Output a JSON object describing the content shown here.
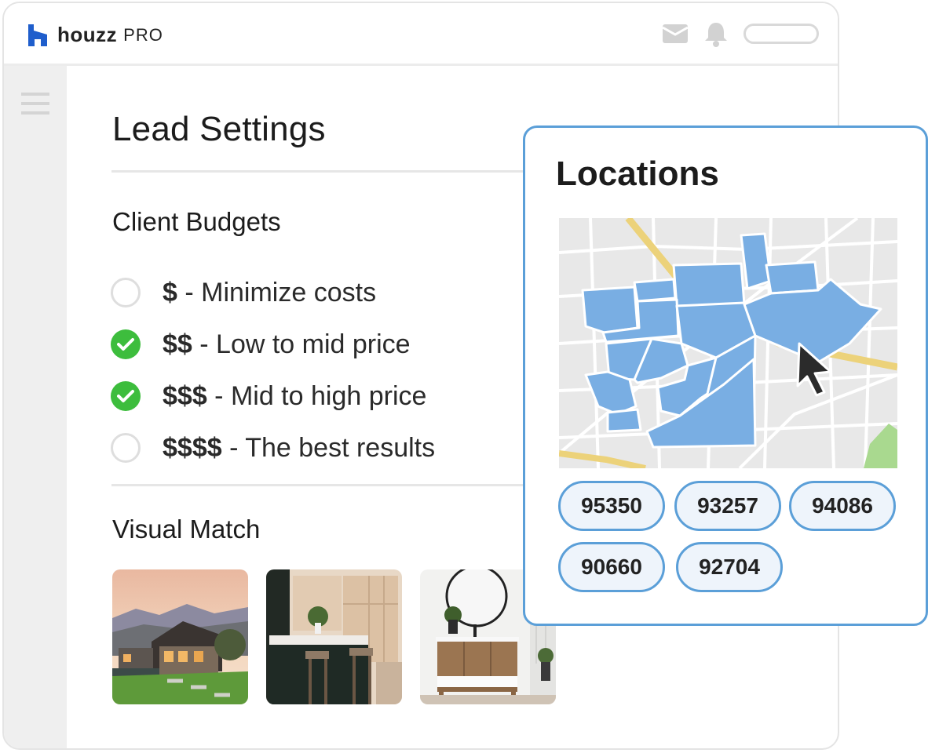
{
  "brand": {
    "name": "houzz",
    "suffix": "PRO",
    "color": "#1f5ecc"
  },
  "page": {
    "title": "Lead Settings"
  },
  "budgets": {
    "title": "Client Budgets",
    "options": [
      {
        "symbol": "$",
        "label": " - Minimize costs",
        "checked": false
      },
      {
        "symbol": "$$",
        "label": " - Low to mid price",
        "checked": true
      },
      {
        "symbol": "$$$",
        "label": " - Mid to high price",
        "checked": true
      },
      {
        "symbol": "$$$$",
        "label": " - The best results",
        "checked": false
      }
    ]
  },
  "visual_match": {
    "title": "Visual Match",
    "images": [
      "house-exterior-image",
      "kitchen-image",
      "bathroom-vanity-image"
    ]
  },
  "locations": {
    "title": "Locations",
    "zip_codes": [
      "95350",
      "93257",
      "94086",
      "90660",
      "92704"
    ]
  },
  "colors": {
    "check_green": "#3dbd3d",
    "accent_blue": "#5b9fd8",
    "region_blue": "#79aee3",
    "map_bg": "#e8e8e8"
  },
  "icons": [
    "mail-icon",
    "bell-icon",
    "hamburger-icon",
    "checkmark-icon",
    "cursor-icon"
  ]
}
